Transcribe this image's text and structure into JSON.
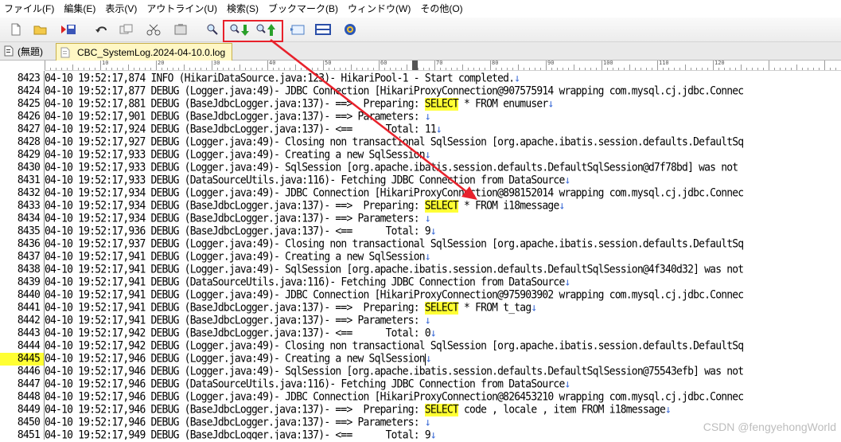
{
  "menu": [
    "ファイル(F)",
    "編集(E)",
    "表示(V)",
    "アウトライン(U)",
    "検索(S)",
    "ブックマーク(B)",
    "ウィンドウ(W)",
    "その他(O)"
  ],
  "toolbar": {
    "buttons": [
      "new-file-icon",
      "open-folder-icon",
      "save-icon",
      "undo-icon",
      "copy-icon",
      "cut-icon",
      "paste-icon",
      "find-icon",
      "find-next-icon",
      "find-previous-icon",
      "window-icon",
      "split-icon",
      "settings-icon"
    ]
  },
  "tabs": [
    {
      "label": "(無題)"
    },
    {
      "label": "CBC_SystemLog.2024-04-10.0.log"
    }
  ],
  "ruler": {
    "numbers": [
      "10",
      "20",
      "30",
      "40",
      "50",
      "60",
      "70",
      "80",
      "90",
      "100",
      "110",
      "120"
    ]
  },
  "editor": {
    "highlight_word": "SELECT",
    "current_line": "8445",
    "lines": [
      {
        "n": "8423",
        "pre": "04-10 19:52:17,874 INFO (HikariDataSource.java:123)- HikariPool-1 - Start completed.",
        "kw": "",
        "post": "",
        "eol": true
      },
      {
        "n": "8424",
        "pre": "04-10 19:52:17,877 DEBUG (Logger.java:49)- JDBC Connection [HikariProxyConnection@907575914 wrapping com.mysql.cj.jdbc.Connec",
        "kw": "",
        "post": "",
        "eol": false
      },
      {
        "n": "8425",
        "pre": "04-10 19:52:17,881 DEBUG (BaseJdbcLogger.java:137)- ==>  Preparing: ",
        "kw": "SELECT",
        "post": " * FROM enumuser",
        "eol": true
      },
      {
        "n": "8426",
        "pre": "04-10 19:52:17,901 DEBUG (BaseJdbcLogger.java:137)- ==> Parameters: ",
        "kw": "",
        "post": "",
        "eol": true
      },
      {
        "n": "8427",
        "pre": "04-10 19:52:17,924 DEBUG (BaseJdbcLogger.java:137)- <==      Total: 11",
        "kw": "",
        "post": "",
        "eol": true
      },
      {
        "n": "8428",
        "pre": "04-10 19:52:17,927 DEBUG (Logger.java:49)- Closing non transactional SqlSession [org.apache.ibatis.session.defaults.DefaultSq",
        "kw": "",
        "post": "",
        "eol": false
      },
      {
        "n": "8429",
        "pre": "04-10 19:52:17,933 DEBUG (Logger.java:49)- Creating a new SqlSession",
        "kw": "",
        "post": "",
        "eol": true
      },
      {
        "n": "8430",
        "pre": "04-10 19:52:17,933 DEBUG (Logger.java:49)- SqlSession [org.apache.ibatis.session.defaults.DefaultSqlSession@d7f78bd] was not ",
        "kw": "",
        "post": "",
        "eol": false
      },
      {
        "n": "8431",
        "pre": "04-10 19:52:17,933 DEBUG (DataSourceUtils.java:116)- Fetching JDBC Connection from DataSource",
        "kw": "",
        "post": "",
        "eol": true
      },
      {
        "n": "8432",
        "pre": "04-10 19:52:17,934 DEBUG (Logger.java:49)- JDBC Connection [HikariProxyConnection@898152014 wrapping com.mysql.cj.jdbc.Connec",
        "kw": "",
        "post": "",
        "eol": false
      },
      {
        "n": "8433",
        "pre": "04-10 19:52:17,934 DEBUG (BaseJdbcLogger.java:137)- ==>  Preparing: ",
        "kw": "SELECT",
        "post": " * FROM i18message",
        "eol": true
      },
      {
        "n": "8434",
        "pre": "04-10 19:52:17,934 DEBUG (BaseJdbcLogger.java:137)- ==> Parameters: ",
        "kw": "",
        "post": "",
        "eol": true
      },
      {
        "n": "8435",
        "pre": "04-10 19:52:17,936 DEBUG (BaseJdbcLogger.java:137)- <==      Total: 9",
        "kw": "",
        "post": "",
        "eol": true
      },
      {
        "n": "8436",
        "pre": "04-10 19:52:17,937 DEBUG (Logger.java:49)- Closing non transactional SqlSession [org.apache.ibatis.session.defaults.DefaultSq",
        "kw": "",
        "post": "",
        "eol": false
      },
      {
        "n": "8437",
        "pre": "04-10 19:52:17,941 DEBUG (Logger.java:49)- Creating a new SqlSession",
        "kw": "",
        "post": "",
        "eol": true
      },
      {
        "n": "8438",
        "pre": "04-10 19:52:17,941 DEBUG (Logger.java:49)- SqlSession [org.apache.ibatis.session.defaults.DefaultSqlSession@4f340d32] was not",
        "kw": "",
        "post": "",
        "eol": false
      },
      {
        "n": "8439",
        "pre": "04-10 19:52:17,941 DEBUG (DataSourceUtils.java:116)- Fetching JDBC Connection from DataSource",
        "kw": "",
        "post": "",
        "eol": true
      },
      {
        "n": "8440",
        "pre": "04-10 19:52:17,941 DEBUG (Logger.java:49)- JDBC Connection [HikariProxyConnection@975903902 wrapping com.mysql.cj.jdbc.Connec",
        "kw": "",
        "post": "",
        "eol": false
      },
      {
        "n": "8441",
        "pre": "04-10 19:52:17,941 DEBUG (BaseJdbcLogger.java:137)- ==>  Preparing: ",
        "kw": "SELECT",
        "post": " * FROM t_tag",
        "eol": true
      },
      {
        "n": "8442",
        "pre": "04-10 19:52:17,941 DEBUG (BaseJdbcLogger.java:137)- ==> Parameters: ",
        "kw": "",
        "post": "",
        "eol": true
      },
      {
        "n": "8443",
        "pre": "04-10 19:52:17,942 DEBUG (BaseJdbcLogger.java:137)- <==      Total: 0",
        "kw": "",
        "post": "",
        "eol": true
      },
      {
        "n": "8444",
        "pre": "04-10 19:52:17,942 DEBUG (Logger.java:49)- Closing non transactional SqlSession [org.apache.ibatis.session.defaults.DefaultSq",
        "kw": "",
        "post": "",
        "eol": false
      },
      {
        "n": "8445",
        "pre": "04-10 19:52:17,946 DEBUG (Logger.java:49)- Creating a new SqlSession",
        "kw": "",
        "post": "",
        "eol": true,
        "caret": true
      },
      {
        "n": "8446",
        "pre": "04-10 19:52:17,946 DEBUG (Logger.java:49)- SqlSession [org.apache.ibatis.session.defaults.DefaultSqlSession@75543efb] was not",
        "kw": "",
        "post": "",
        "eol": false
      },
      {
        "n": "8447",
        "pre": "04-10 19:52:17,946 DEBUG (DataSourceUtils.java:116)- Fetching JDBC Connection from DataSource",
        "kw": "",
        "post": "",
        "eol": true
      },
      {
        "n": "8448",
        "pre": "04-10 19:52:17,946 DEBUG (Logger.java:49)- JDBC Connection [HikariProxyConnection@826453210 wrapping com.mysql.cj.jdbc.Connec",
        "kw": "",
        "post": "",
        "eol": false
      },
      {
        "n": "8449",
        "pre": "04-10 19:52:17,946 DEBUG (BaseJdbcLogger.java:137)- ==>  Preparing: ",
        "kw": "SELECT",
        "post": " code , locale , item FROM i18message",
        "eol": true
      },
      {
        "n": "8450",
        "pre": "04-10 19:52:17,946 DEBUG (BaseJdbcLogger.java:137)- ==> Parameters: ",
        "kw": "",
        "post": "",
        "eol": true
      },
      {
        "n": "8451",
        "pre": "04-10 19:52:17,949 DEBUG (BaseJdbcLogger.java:137)- <==      Total: 9",
        "kw": "",
        "post": "",
        "eol": true
      }
    ]
  },
  "watermark": "CSDN @fengyehongWorld",
  "colors": {
    "highlight": "#ffff33",
    "annotation": "#e8212b",
    "eol": "#3a6ad6"
  }
}
